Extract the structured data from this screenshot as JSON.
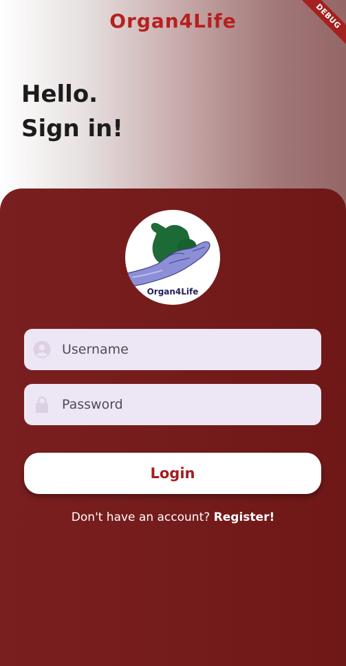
{
  "app": {
    "title": "Organ4Life",
    "debug_banner": "DEBUG"
  },
  "greeting": {
    "line1": "Hello.",
    "line2": "Sign in!"
  },
  "logo": {
    "text": "Organ4Life",
    "icon": "heart-in-hand-icon"
  },
  "form": {
    "username": {
      "placeholder": "Username",
      "value": "",
      "icon": "user-icon"
    },
    "password": {
      "placeholder": "Password",
      "value": "",
      "icon": "lock-icon"
    },
    "login_label": "Login"
  },
  "register": {
    "prompt": "Don't have an account?",
    "link_label": "Register!"
  },
  "colors": {
    "brand_red": "#b5211f",
    "card_red": "#731a1a",
    "field_bg": "#ede6f5"
  }
}
